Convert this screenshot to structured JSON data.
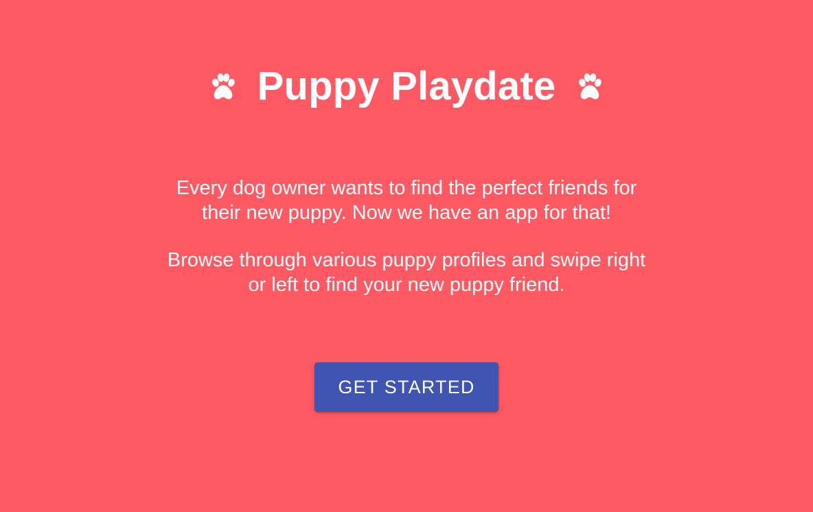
{
  "app": {
    "title": "Puppy Playdate",
    "left_icon": "paw-icon",
    "right_icon": "paw-icon"
  },
  "content": {
    "paragraph_1": {
      "line_1": "Every dog owner wants to find the perfect friends for",
      "line_2": "their new puppy. Now we have an app for that!"
    },
    "paragraph_2": {
      "line_1": "Browse through various puppy profiles and swipe right",
      "line_2": "or left to find your new puppy friend."
    }
  },
  "actions": {
    "get_started_label": "GET STARTED"
  },
  "colors": {
    "background": "#ff5a64",
    "text": "#ffffff",
    "button": "#4054b4"
  }
}
